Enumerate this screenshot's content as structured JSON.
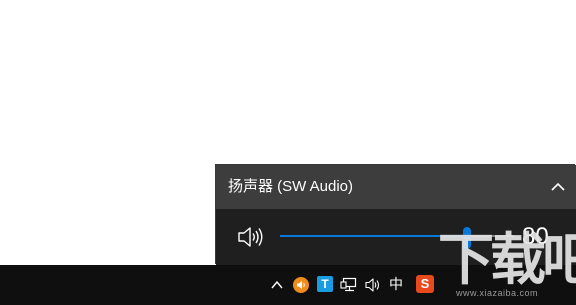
{
  "volume_flyout": {
    "device_name": "扬声器 (SW Audio)",
    "volume": 80,
    "volume_label": "80",
    "collapse_icon": "chevron-up-icon",
    "speaker_icon": "speaker-volume-icon",
    "accent_color": "#0a78d7"
  },
  "taskbar": {
    "tray": [
      {
        "name": "show-hidden-icons",
        "icon": "chevron-up-icon"
      },
      {
        "name": "orange-audio-app",
        "icon": "orange-circle-speaker-icon",
        "color": "#f08c1e"
      },
      {
        "name": "blue-t-app",
        "label": "T",
        "color": "#1a9de0"
      },
      {
        "name": "network",
        "icon": "network-computer-icon"
      },
      {
        "name": "volume",
        "icon": "speaker-icon"
      },
      {
        "name": "input-method",
        "label": "中"
      },
      {
        "name": "sogou-ime",
        "label": "S",
        "color": "#e8491d"
      }
    ]
  },
  "watermark": {
    "brand": "下载吧",
    "url": "www.xiazaiba.com"
  }
}
